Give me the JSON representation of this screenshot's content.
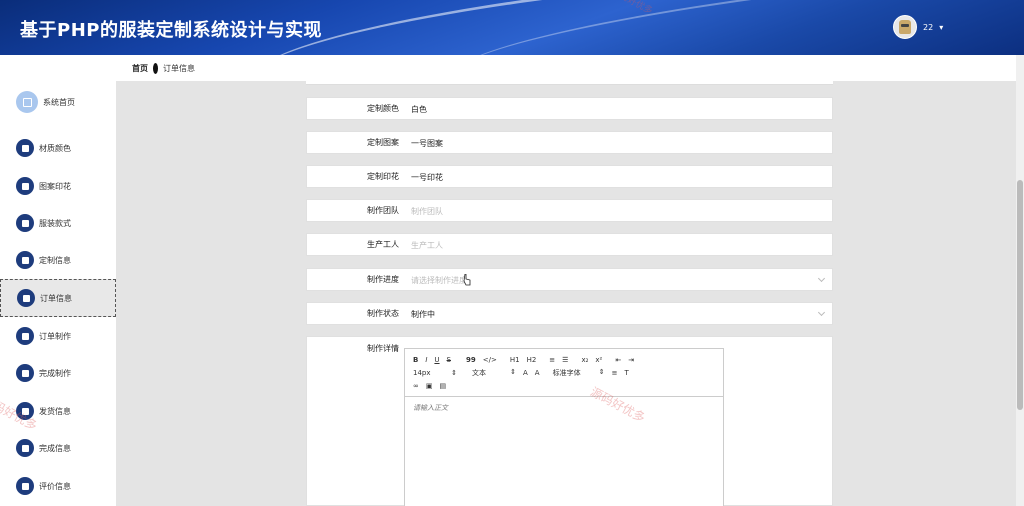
{
  "header": {
    "title": "基于PHP的服装定制系统设计与实现",
    "username": "22",
    "dropdown_glyph": "▾",
    "gradient_colors": [
      "#0a2d7a",
      "#2d63cf"
    ]
  },
  "sidebar": {
    "items": [
      {
        "label": "系统首页",
        "icon": "home-icon"
      },
      {
        "label": "材质颜色",
        "icon": "send-icon"
      },
      {
        "label": "图案印花",
        "icon": "clipboard-icon"
      },
      {
        "label": "服装款式",
        "icon": "user-icon"
      },
      {
        "label": "定制信息",
        "icon": "chart-icon"
      },
      {
        "label": "订单信息",
        "icon": "grid-icon",
        "active": true
      },
      {
        "label": "订单制作",
        "icon": "table-icon"
      },
      {
        "label": "完成制作",
        "icon": "grid-icon"
      },
      {
        "label": "发货信息",
        "icon": "bar-chart-icon"
      },
      {
        "label": "完成信息",
        "icon": "grid-icon"
      },
      {
        "label": "评价信息",
        "icon": "comment-icon"
      }
    ]
  },
  "breadcrumb": {
    "home": "首页",
    "current": "订单信息"
  },
  "form": {
    "fields": [
      {
        "label": "定制颜色",
        "value": "白色"
      },
      {
        "label": "定制图案",
        "value": "一号图案"
      },
      {
        "label": "定制印花",
        "value": "一号印花"
      },
      {
        "label": "制作团队",
        "placeholder": "制作团队"
      },
      {
        "label": "生产工人",
        "placeholder": "生产工人"
      },
      {
        "label": "制作进度",
        "placeholder": "请选择制作进度"
      },
      {
        "label": "制作状态",
        "value": "制作中"
      }
    ],
    "detail_label": "制作详情"
  },
  "editor": {
    "toolbar_row1": [
      "B",
      "I",
      "U",
      "S",
      "99",
      "</>",
      "H1",
      "H2",
      "≡",
      "☰",
      "x₂",
      "x²",
      "⇤",
      "⇥"
    ],
    "font_size": "14px",
    "text_type": "文本",
    "font_family": "标准字体",
    "placeholder": "请输入正文"
  },
  "watermark": "源码好优多",
  "accent_color": "#1e3c7d"
}
